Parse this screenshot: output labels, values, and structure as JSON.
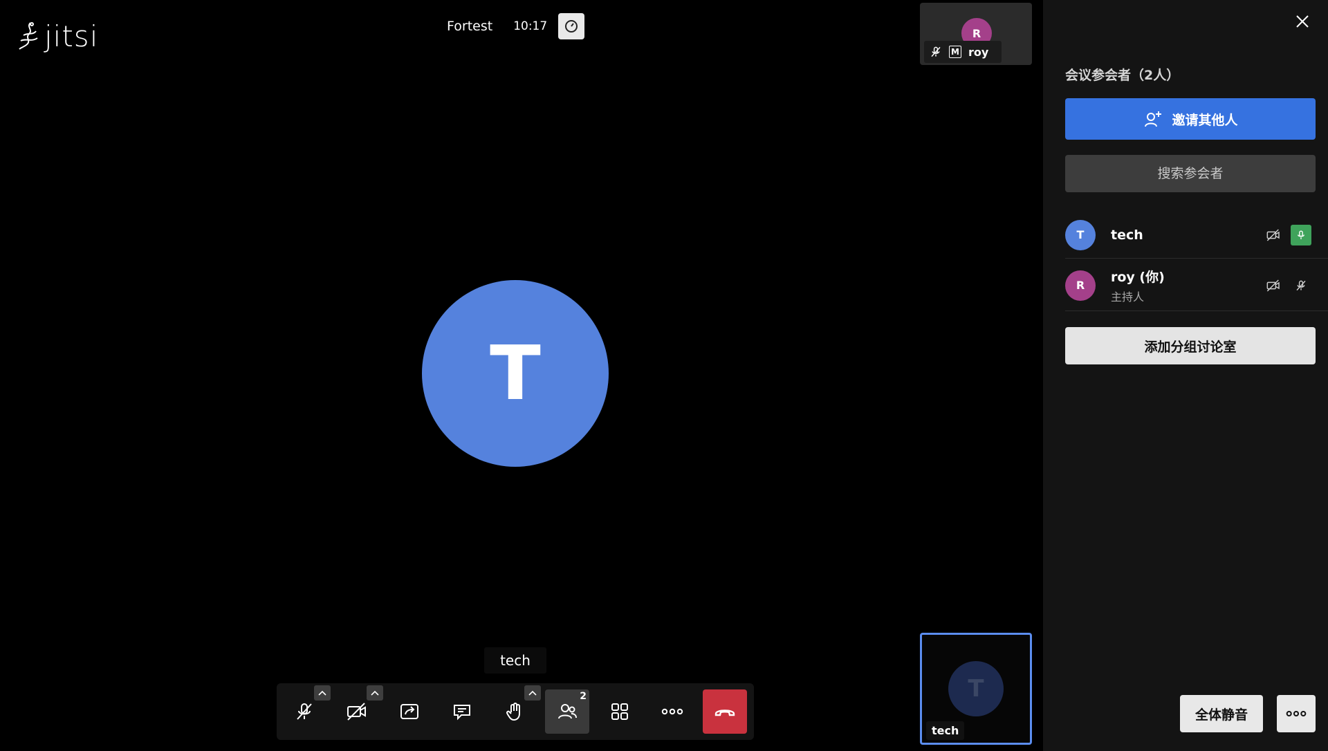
{
  "app": {
    "logo_text": "jitsi"
  },
  "header": {
    "meeting_name": "Fortest",
    "time": "10:17"
  },
  "dominant": {
    "initial": "T",
    "name": "tech",
    "avatar_color": "#5582dd"
  },
  "filmstrip": {
    "local": {
      "initial": "R",
      "name": "roy",
      "moderator_badge": "M",
      "avatar_color": "#a4408a"
    },
    "remote": {
      "initial": "T",
      "name": "tech"
    }
  },
  "toolbar": {
    "participants_count": "2",
    "buttons": [
      "microphone",
      "camera",
      "share-screen",
      "chat",
      "raise-hand",
      "participants",
      "tile-view",
      "more-actions",
      "leave"
    ]
  },
  "panel": {
    "title": "会议参会者（2人）",
    "invite_label": "邀请其他人",
    "search_placeholder": "搜索参会者",
    "participants": [
      {
        "initial": "T",
        "name": "tech",
        "role": "",
        "avatar_color": "#5582dd"
      },
      {
        "initial": "R",
        "name": "roy (你)",
        "role": "主持人",
        "avatar_color": "#a4408a"
      }
    ],
    "breakout_label": "添加分组讨论室",
    "mute_all_label": "全体静音"
  },
  "colors": {
    "accent": "#3672e0",
    "hangup": "#c9323e",
    "mic_active": "#3fa35b"
  }
}
